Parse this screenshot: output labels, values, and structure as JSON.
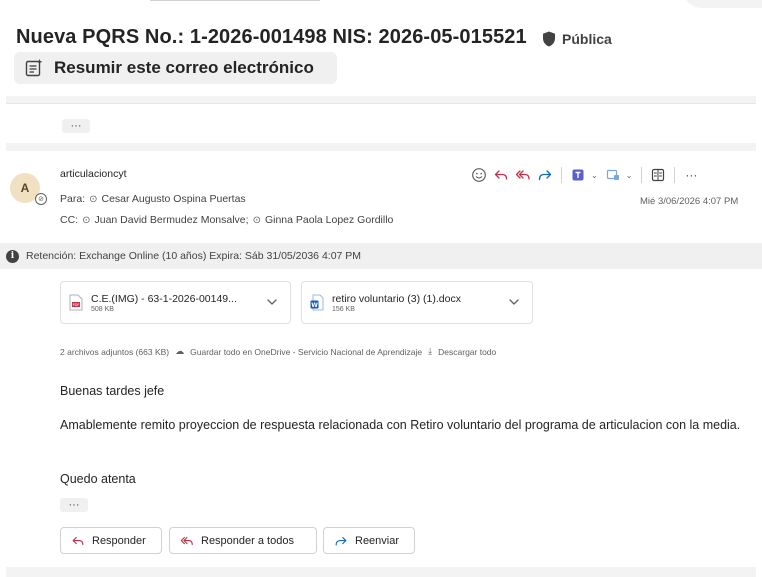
{
  "header": {
    "subject": "Nueva PQRS No.: 1-2026-001498 NIS: 2026-05-015521",
    "sensitivity_label": "Pública",
    "summarize_label": "Resumir este correo electrónico"
  },
  "thread": {
    "collapsed_indicator": "···"
  },
  "message": {
    "avatar_initial": "A",
    "sender": "articulacioncyt",
    "to_prefix": "Para:",
    "to": "Cesar Augusto Ospina Puertas",
    "cc_prefix": "CC:",
    "cc": [
      "Juan David Bermudez Monsalve;",
      "Ginna Paola Lopez Gordillo"
    ],
    "date": "Mié 3/06/2026 4:07 PM",
    "retention": "Retención: Exchange Online (10 años) Expira: Sáb 31/05/2036 4:07 PM",
    "actions": {
      "emoji_icon": "emoji-icon",
      "reply_icon": "reply-icon",
      "reply_all_icon": "reply-all-icon",
      "forward_icon": "forward-icon",
      "more_label": "···"
    },
    "attachments": [
      {
        "name": "C.E.(IMG) - 63-1-2026-00149...",
        "size": "508 KB",
        "icon": "pdf-file-icon"
      },
      {
        "name": "retiro voluntario (3) (1).docx",
        "size": "156 KB",
        "icon": "word-file-icon"
      }
    ],
    "attachments_summary": {
      "count": "2 archivos adjuntos (663 KB)",
      "save_all": "Guardar todo en OneDrive - Servicio Nacional de Aprendizaje",
      "download_all": "Descargar todo"
    },
    "body": {
      "greeting": "Buenas tardes jefe",
      "paragraph": "Amablemente remito proyeccion de respuesta relacionada con Retiro voluntario del programa de articulacion con la media.",
      "closing": "Quedo atenta",
      "trimmed_indicator": "···"
    },
    "reply_buttons": {
      "reply": "Responder",
      "reply_all": "Responder a todos",
      "forward": "Reenviar"
    }
  },
  "colors": {
    "accent": "#0f6cbd",
    "text": "#242424",
    "muted": "#616161",
    "bar": "#f0f0f0"
  }
}
